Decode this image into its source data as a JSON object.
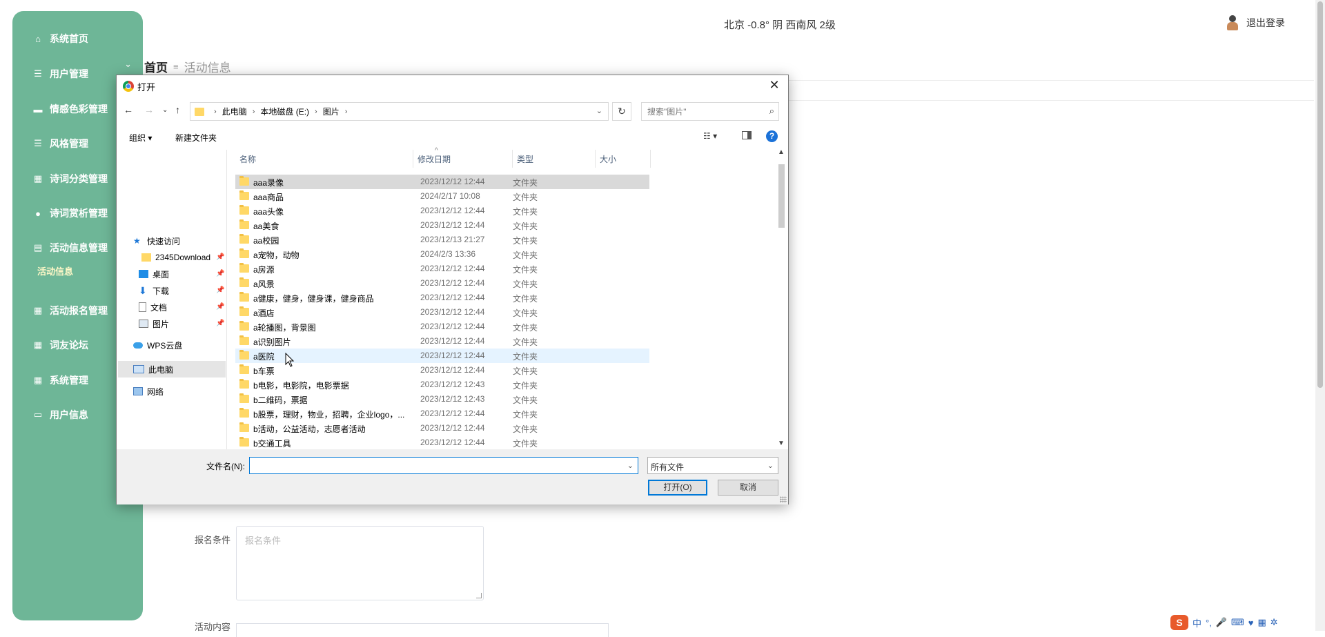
{
  "sidebar": {
    "items": [
      {
        "icon": "home-icon",
        "glyph": "⌂",
        "label": "系统首页"
      },
      {
        "icon": "list-icon",
        "glyph": "☰",
        "label": "用户管理"
      },
      {
        "icon": "monitor-icon",
        "glyph": "▬",
        "label": "情感色彩管理"
      },
      {
        "icon": "list-icon",
        "glyph": "☰",
        "label": "风格管理"
      },
      {
        "icon": "grid-icon",
        "glyph": "▦",
        "label": "诗词分类管理"
      },
      {
        "icon": "person-icon",
        "glyph": "●",
        "label": "诗词赏析管理"
      },
      {
        "icon": "clipboard-icon",
        "glyph": "▤",
        "label": "活动信息管理"
      },
      {
        "icon": "grid-icon",
        "glyph": "▦",
        "label": "活动报名管理"
      },
      {
        "icon": "grid-icon",
        "glyph": "▦",
        "label": "词友论坛"
      },
      {
        "icon": "grid-icon",
        "glyph": "▦",
        "label": "系统管理"
      },
      {
        "icon": "card-icon",
        "glyph": "▭",
        "label": "用户信息"
      }
    ],
    "active_sub": "活动信息"
  },
  "header": {
    "weather": "北京  -0.8°  阴  西南风  2级",
    "logout": "退出登录"
  },
  "breadcrumb": {
    "home": "首页",
    "current": "活动信息"
  },
  "form": {
    "signup_label": "报名条件",
    "signup_placeholder": "报名条件",
    "content_label": "活动内容"
  },
  "dialog": {
    "title": "打开",
    "address": [
      "此电脑",
      "本地磁盘 (E:)",
      "图片"
    ],
    "search_placeholder": "搜索\"图片\"",
    "toolbar": {
      "organize": "组织 ▾",
      "new_folder": "新建文件夹"
    },
    "nav": {
      "quick_access": "快速访问",
      "pinned": [
        "2345Download",
        "桌面",
        "下载",
        "文档",
        "图片"
      ],
      "wps": "WPS云盘",
      "this_pc": "此电脑",
      "network": "网络"
    },
    "columns": {
      "name": "名称",
      "date": "修改日期",
      "type": "类型",
      "size": "大小"
    },
    "files": [
      {
        "name": "aaa录像",
        "date": "2023/12/12 12:44",
        "type": "文件夹"
      },
      {
        "name": "aaa商品",
        "date": "2024/2/17 10:08",
        "type": "文件夹"
      },
      {
        "name": "aaa头像",
        "date": "2023/12/12 12:44",
        "type": "文件夹"
      },
      {
        "name": "aa美食",
        "date": "2023/12/12 12:44",
        "type": "文件夹"
      },
      {
        "name": "aa校园",
        "date": "2023/12/13 21:27",
        "type": "文件夹"
      },
      {
        "name": "a宠物，动物",
        "date": "2024/2/3 13:36",
        "type": "文件夹"
      },
      {
        "name": "a房源",
        "date": "2023/12/12 12:44",
        "type": "文件夹"
      },
      {
        "name": "a风景",
        "date": "2023/12/12 12:44",
        "type": "文件夹"
      },
      {
        "name": "a健康，健身，健身课，健身商品",
        "date": "2023/12/12 12:44",
        "type": "文件夹"
      },
      {
        "name": "a酒店",
        "date": "2023/12/12 12:44",
        "type": "文件夹"
      },
      {
        "name": "a轮播图，背景图",
        "date": "2023/12/12 12:44",
        "type": "文件夹"
      },
      {
        "name": "a识别图片",
        "date": "2023/12/12 12:44",
        "type": "文件夹"
      },
      {
        "name": "a医院",
        "date": "2023/12/12 12:44",
        "type": "文件夹"
      },
      {
        "name": "b车票",
        "date": "2023/12/12 12:44",
        "type": "文件夹"
      },
      {
        "name": "b电影，电影院，电影票据",
        "date": "2023/12/12 12:43",
        "type": "文件夹"
      },
      {
        "name": "b二维码，票据",
        "date": "2023/12/12 12:43",
        "type": "文件夹"
      },
      {
        "name": "b股票，理财，物业，招聘，企业logo，...",
        "date": "2023/12/12 12:44",
        "type": "文件夹"
      },
      {
        "name": "b活动，公益活动，志愿者活动",
        "date": "2023/12/12 12:44",
        "type": "文件夹"
      },
      {
        "name": "b交通工具",
        "date": "2023/12/12 12:44",
        "type": "文件夹"
      }
    ],
    "filename_label": "文件名(N):",
    "filename_value": "",
    "filetype": "所有文件",
    "open_button": "打开(O)",
    "cancel_button": "取消"
  },
  "ime": {
    "mode": "中",
    "punct": "°,"
  }
}
